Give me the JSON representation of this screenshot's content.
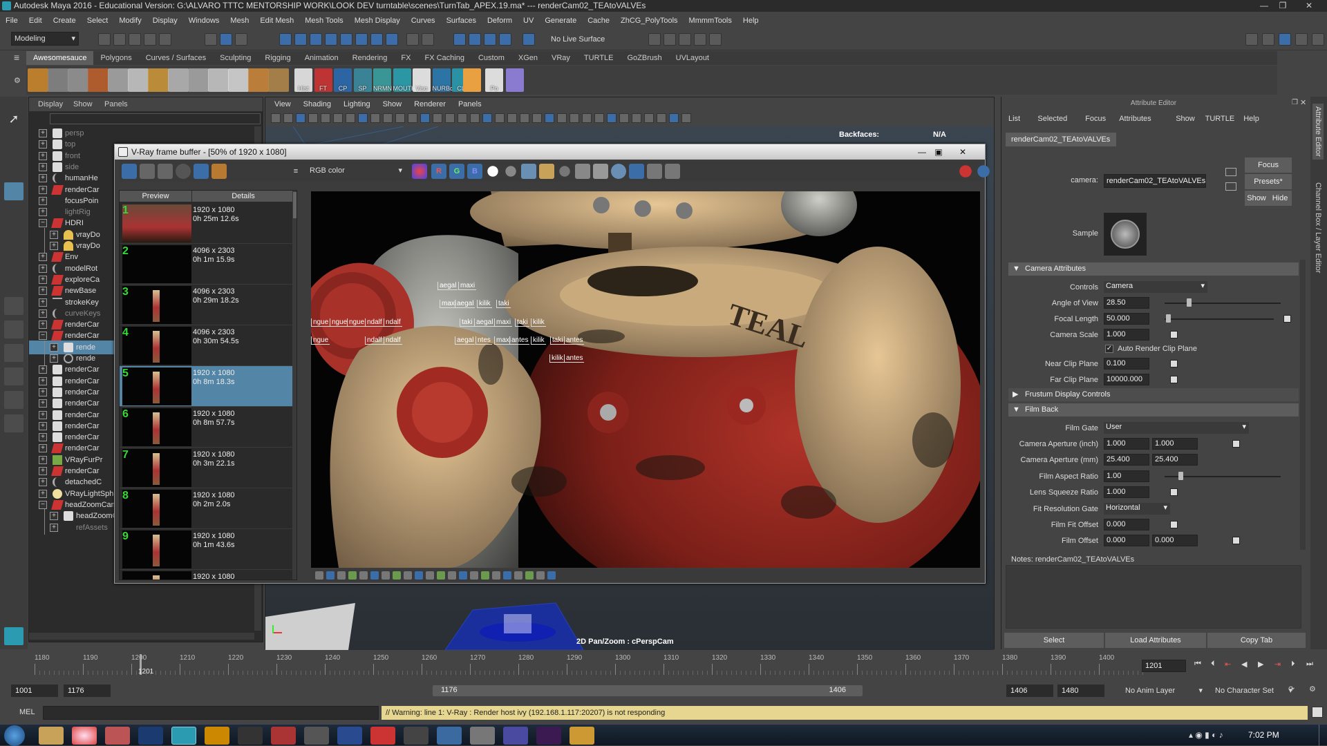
{
  "window": {
    "title": "Autodesk Maya 2016 - Educational Version: G:\\ALVARO TTTC MENTORSHIP WORK\\LOOK DEV turntable\\scenes\\TurnTab_APEX.19.ma*   ---   renderCam02_TEAtoVALVEs"
  },
  "menubar": [
    "File",
    "Edit",
    "Create",
    "Select",
    "Modify",
    "Display",
    "Windows",
    "Mesh",
    "Edit Mesh",
    "Mesh Tools",
    "Mesh Display",
    "Curves",
    "Surfaces",
    "Deform",
    "UV",
    "Generate",
    "Cache",
    "ZhCG_PolyTools",
    "MmmmTools",
    "Help"
  ],
  "statusline": {
    "mode": "Modeling",
    "live_surface": "No Live Surface"
  },
  "shelf": {
    "tabs": [
      "Awesomesauce",
      "Polygons",
      "Curves / Surfaces",
      "Sculpting",
      "Rigging",
      "Animation",
      "Rendering",
      "FX",
      "FX Caching",
      "Custom",
      "XGen",
      "VRay",
      "TURTLE",
      "GoZBrush",
      "UVLayout"
    ],
    "icon_labels": [
      "Hist",
      "FT",
      "CP",
      "SP",
      "NRMN",
      "MOUTH",
      "Viso",
      "NURBc",
      "CL",
      "Po"
    ]
  },
  "outliner": {
    "menu": [
      "Display",
      "Show",
      "Panels"
    ],
    "rows": [
      {
        "label": "persp",
        "type": "camera",
        "grey": true
      },
      {
        "label": "top",
        "type": "camera",
        "grey": true
      },
      {
        "label": "front",
        "type": "camera",
        "grey": true
      },
      {
        "label": "side",
        "type": "camera",
        "grey": true
      },
      {
        "label": "humanHe",
        "type": "curve"
      },
      {
        "label": "renderCar",
        "type": "group"
      },
      {
        "label": "focusPoin",
        "type": "locator"
      },
      {
        "label": "lightRig",
        "type": "locator",
        "grey": true
      },
      {
        "label": "HDRI",
        "type": "group",
        "expanded": true
      },
      {
        "label": "vrayDo",
        "type": "light",
        "indent": 1
      },
      {
        "label": "vrayDo",
        "type": "light",
        "indent": 1
      },
      {
        "label": "Env",
        "type": "group"
      },
      {
        "label": "modelRot",
        "type": "curve"
      },
      {
        "label": "exploreCa",
        "type": "group"
      },
      {
        "label": "newBase",
        "type": "group"
      },
      {
        "label": "strokeKey",
        "type": "stroke"
      },
      {
        "label": "curveKeys",
        "type": "curve",
        "grey": true
      },
      {
        "label": "renderCar",
        "type": "group"
      },
      {
        "label": "renderCar",
        "type": "group",
        "expanded": true
      },
      {
        "label": "rende",
        "type": "camera",
        "indent": 1,
        "selected": true
      },
      {
        "label": "rende",
        "type": "aim",
        "indent": 1
      },
      {
        "label": "renderCar",
        "type": "camera"
      },
      {
        "label": "renderCar",
        "type": "camera"
      },
      {
        "label": "renderCar",
        "type": "camera"
      },
      {
        "label": "renderCar",
        "type": "camera"
      },
      {
        "label": "renderCar",
        "type": "camera"
      },
      {
        "label": "renderCar",
        "type": "camera"
      },
      {
        "label": "renderCar",
        "type": "camera"
      },
      {
        "label": "renderCar",
        "type": "group"
      },
      {
        "label": "VRayFurPr",
        "type": "fur"
      },
      {
        "label": "renderCar",
        "type": "group"
      },
      {
        "label": "detachedC",
        "type": "curve"
      },
      {
        "label": "VRayLightSphere1",
        "type": "sphere"
      },
      {
        "label": "headZoomCam",
        "type": "group",
        "expanded": true
      },
      {
        "label": "headZoomCam",
        "type": "camera",
        "indent": 1
      },
      {
        "label": "refAssets",
        "type": "locator",
        "indent": 1,
        "grey": true
      }
    ]
  },
  "viewport": {
    "menu": [
      "View",
      "Shading",
      "Lighting",
      "Show",
      "Renderer",
      "Panels"
    ],
    "hud": {
      "backfaces_label": "Backfaces:",
      "backfaces_value": "N/A"
    },
    "pan_zoom": "2D Pan/Zoom : cPerspCam"
  },
  "vfb": {
    "title": "V-Ray frame buffer - [50% of 1920 x 1080]",
    "channel": "RGB color",
    "history_headers": [
      "Preview",
      "Details"
    ],
    "history": [
      {
        "num": "1",
        "res": "1920 x 1080",
        "time": "0h 25m 12.6s"
      },
      {
        "num": "2",
        "res": "4096 x 2303",
        "time": "0h 1m 15.9s"
      },
      {
        "num": "3",
        "res": "4096 x 2303",
        "time": "0h 29m 18.2s"
      },
      {
        "num": "4",
        "res": "4096 x 2303",
        "time": "0h 30m 54.5s"
      },
      {
        "num": "5",
        "res": "1920 x 1080",
        "time": "0h 8m 18.3s",
        "selected": true
      },
      {
        "num": "6",
        "res": "1920 x 1080",
        "time": "0h 8m 57.7s"
      },
      {
        "num": "7",
        "res": "1920 x 1080",
        "time": "0h 3m 22.1s"
      },
      {
        "num": "8",
        "res": "1920 x 1080",
        "time": "0h 2m 2.0s"
      },
      {
        "num": "9",
        "res": "1920 x 1080",
        "time": "0h 1m 43.6s"
      },
      {
        "num": "",
        "res": "1920 x 1080",
        "time": ""
      }
    ],
    "annotations": [
      "aegal",
      "maxi",
      "maxi",
      "aegal",
      "kilik",
      "taki",
      "ngue",
      "ngue",
      "ngue",
      "ndalf",
      "ndalf",
      "taki",
      "aegal",
      "maxi",
      "taki",
      "kilik",
      "ngue",
      "ndalf",
      "ndalf",
      "aegal",
      "ntes",
      "maxi",
      "antes",
      "kilik",
      "taki",
      "antes",
      "kilik",
      "antes"
    ],
    "render_text": "TEAL"
  },
  "attribute_editor": {
    "title": "Attribute Editor",
    "menu": [
      "List",
      "Selected",
      "Focus",
      "Attributes",
      "Show",
      "TURTLE",
      "Help"
    ],
    "node_tab": "renderCam02_TEAtoVALVEs",
    "camera_label": "camera:",
    "camera_value": "renderCam02_TEAtoVALVEs",
    "buttons": {
      "focus": "Focus",
      "presets": "Presets*",
      "show": "Show",
      "hide": "Hide"
    },
    "sample_label": "Sample",
    "sections": {
      "camera_attributes": "Camera Attributes",
      "frustum": "Frustum Display Controls",
      "film_back": "Film Back"
    },
    "camera_attrs": {
      "controls_label": "Controls",
      "controls_value": "Camera",
      "aov_label": "Angle of View",
      "aov_value": "28.50",
      "focal_label": "Focal Length",
      "focal_value": "50.000",
      "scale_label": "Camera Scale",
      "scale_value": "1.000",
      "auto_clip": "Auto Render Clip Plane",
      "near_label": "Near Clip Plane",
      "near_value": "0.100",
      "far_label": "Far Clip Plane",
      "far_value": "10000.000"
    },
    "film_back": {
      "gate_label": "Film Gate",
      "gate_value": "User",
      "ap_inch_label": "Camera Aperture (inch)",
      "ap_inch_1": "1.000",
      "ap_inch_2": "1.000",
      "ap_mm_label": "Camera Aperture (mm)",
      "ap_mm_1": "25.400",
      "ap_mm_2": "25.400",
      "aspect_label": "Film Aspect Ratio",
      "aspect_value": "1.00",
      "squeeze_label": "Lens Squeeze Ratio",
      "squeeze_value": "1.000",
      "fit_label": "Fit Resolution Gate",
      "fit_value": "Horizontal",
      "fitoff_label": "Film Fit Offset",
      "fitoff_value": "0.000",
      "filmoff_label": "Film Offset",
      "filmoff_1": "0.000",
      "filmoff_2": "0.000"
    },
    "notes": "Notes:  renderCam02_TEAtoVALVEs",
    "bottom_buttons": [
      "Select",
      "Load Attributes",
      "Copy Tab"
    ],
    "side_tabs": [
      "Attribute Editor",
      "Channel Box / Layer Editor"
    ]
  },
  "timeline": {
    "ticks": [
      "1180",
      "1190",
      "1200",
      "1210",
      "1220",
      "1230",
      "1240",
      "1250",
      "1260",
      "1270",
      "1280",
      "1290",
      "1300",
      "1310",
      "1320",
      "1330",
      "1340",
      "1350",
      "1360",
      "1370",
      "1380",
      "1390",
      "1400"
    ],
    "current": "1201",
    "current_field": "1201"
  },
  "range": {
    "start": "1001",
    "playback_start": "1176",
    "slider_start": "1176",
    "slider_end": "1406",
    "playback_end": "1406",
    "end": "1480",
    "anim_layer": "No Anim Layer",
    "character_set": "No Character Set"
  },
  "command": {
    "mel_label": "MEL",
    "warning": "// Warning: line 1: V-Ray : Render host ivy (192.168.1.117:20207) is not responding"
  },
  "taskbar": {
    "clock": "7:02 PM"
  }
}
